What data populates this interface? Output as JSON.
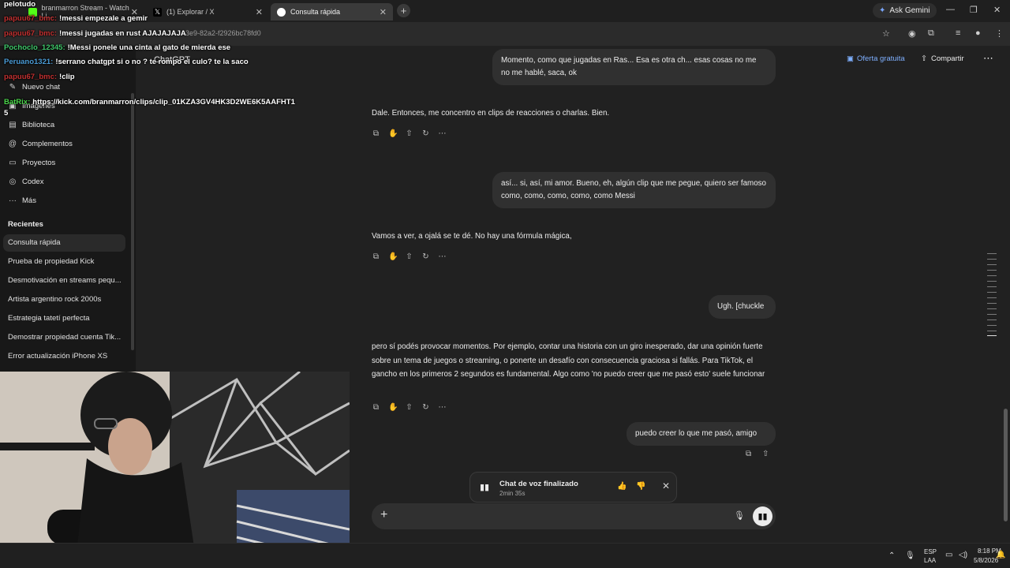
{
  "browser": {
    "tabs": [
      {
        "title": "branmarron Stream - Watch Li..."
      },
      {
        "title": "(1) Explorar / X"
      },
      {
        "title": "Consulta rápida"
      }
    ],
    "ask_gemini": "Ask Gemini",
    "url_fragment": "3e9-82a2-f2926bc78fd0"
  },
  "stream_chat": [
    {
      "user": "",
      "message": "pelotudo",
      "color": "#ffffff"
    },
    {
      "user": "papuu67_bmc:",
      "message": "!messi empezale a gemir",
      "color": "#c23030"
    },
    {
      "user": "papuu67_bmc:",
      "message": "!messi jugadas en rust AJAJAJAJA",
      "color": "#c23030"
    },
    {
      "user": "Pochoclo_12345:",
      "message": "!Messi ponele una cinta al gato de mierda ese",
      "color": "#3fc76a"
    },
    {
      "user": "Peruano1321:",
      "message": "!serrano chatgpt si o no ? te rompo el culo? te la saco",
      "color": "#4a9bd6"
    },
    {
      "user": "papuu67_bmc:",
      "message": "!clip",
      "color": "#c23030"
    },
    {
      "user": "BatRix:",
      "message": "https://kick.com/branmarron/clips/clip_01KZA3GV4HK3D2WE6K5AAFHT1",
      "color": "#4bd64b"
    },
    {
      "user": "",
      "message": "5",
      "color": "#ffffff"
    }
  ],
  "sidebar": {
    "app_title": "ChatGPT",
    "items": [
      {
        "label": "Nuevo chat",
        "icon": "new-chat-icon"
      },
      {
        "label": "Imágenes",
        "icon": "images-icon"
      },
      {
        "label": "Biblioteca",
        "icon": "library-icon"
      },
      {
        "label": "Complementos",
        "icon": "plugins-icon"
      },
      {
        "label": "Proyectos",
        "icon": "folder-icon"
      },
      {
        "label": "Codex",
        "icon": "codex-icon"
      },
      {
        "label": "Más",
        "icon": "more-icon"
      }
    ],
    "recents_label": "Recientes",
    "recents": [
      "Consulta rápida",
      "Prueba de propiedad Kick",
      "Desmotivación en streams pequ...",
      "Artista argentino rock 2000s",
      "Estrategia tatetí perfecta",
      "Demostrar propiedad cuenta Tik...",
      "Error actualización iPhone XS"
    ]
  },
  "header": {
    "offer": "Oferta gratuita",
    "share": "Compartir"
  },
  "conversation": {
    "user_1": "Momento, como que jugadas en Ras... Esa es otra ch... esas cosas no me no me hablé, saca, ok",
    "assistant_1": "Dale. Entonces, me concentro en clips de reacciones o charlas. Bien.",
    "user_2": "así... si, así, mi amor. Bueno, eh, algún clip que me pegue, quiero ser famoso como, como, como, como, como Messi",
    "assistant_2": "Vamos a ver, a ojalá se te dé. No hay una fórmula mágica,",
    "user_3": "Ugh. [chuckle",
    "assistant_3": "pero sí podés provocar momentos. Por ejemplo, contar una historia con un giro inesperado, dar una opinión fuerte sobre un tema de juegos o streaming, o ponerte un desafío con consecuencia graciosa si fallás. Para TikTok, el gancho en los primeros 2 segundos es fundamental. Algo como 'no puedo creer que me pasó esto' suele funcionar",
    "user_4": "puedo creer lo que me pasó, amigo"
  },
  "voice_card": {
    "title": "Chat de voz finalizado",
    "duration": "2min 35s"
  },
  "taskbar": {
    "lang": "ESP",
    "lang2": "LAA",
    "time": "8:18 PM",
    "date": "5/8/2026"
  }
}
